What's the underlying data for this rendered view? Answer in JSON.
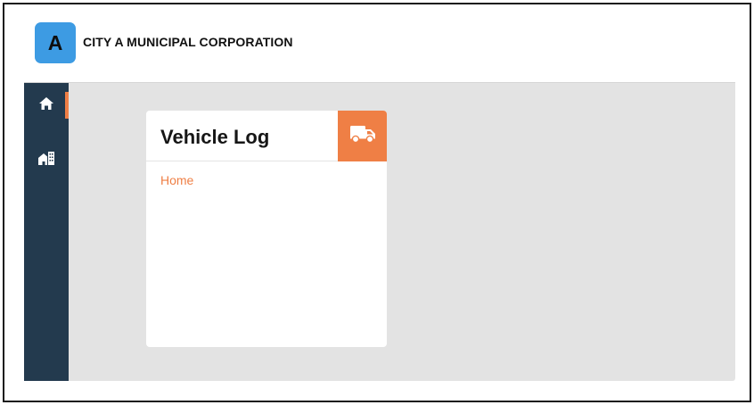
{
  "header": {
    "logo_letter": "A",
    "org_name": "CITY A MUNICIPAL CORPORATION"
  },
  "sidebar": {
    "items": [
      {
        "icon": "home-icon",
        "active": true
      },
      {
        "icon": "building-icon",
        "active": false
      }
    ]
  },
  "card": {
    "title": "Vehicle Log",
    "icon": "truck-icon",
    "link_label": "Home"
  },
  "colors": {
    "logo_bg": "#3d9be3",
    "sidebar_bg": "#233a4e",
    "accent": "#ef7f45",
    "content_bg": "#e3e3e3"
  }
}
